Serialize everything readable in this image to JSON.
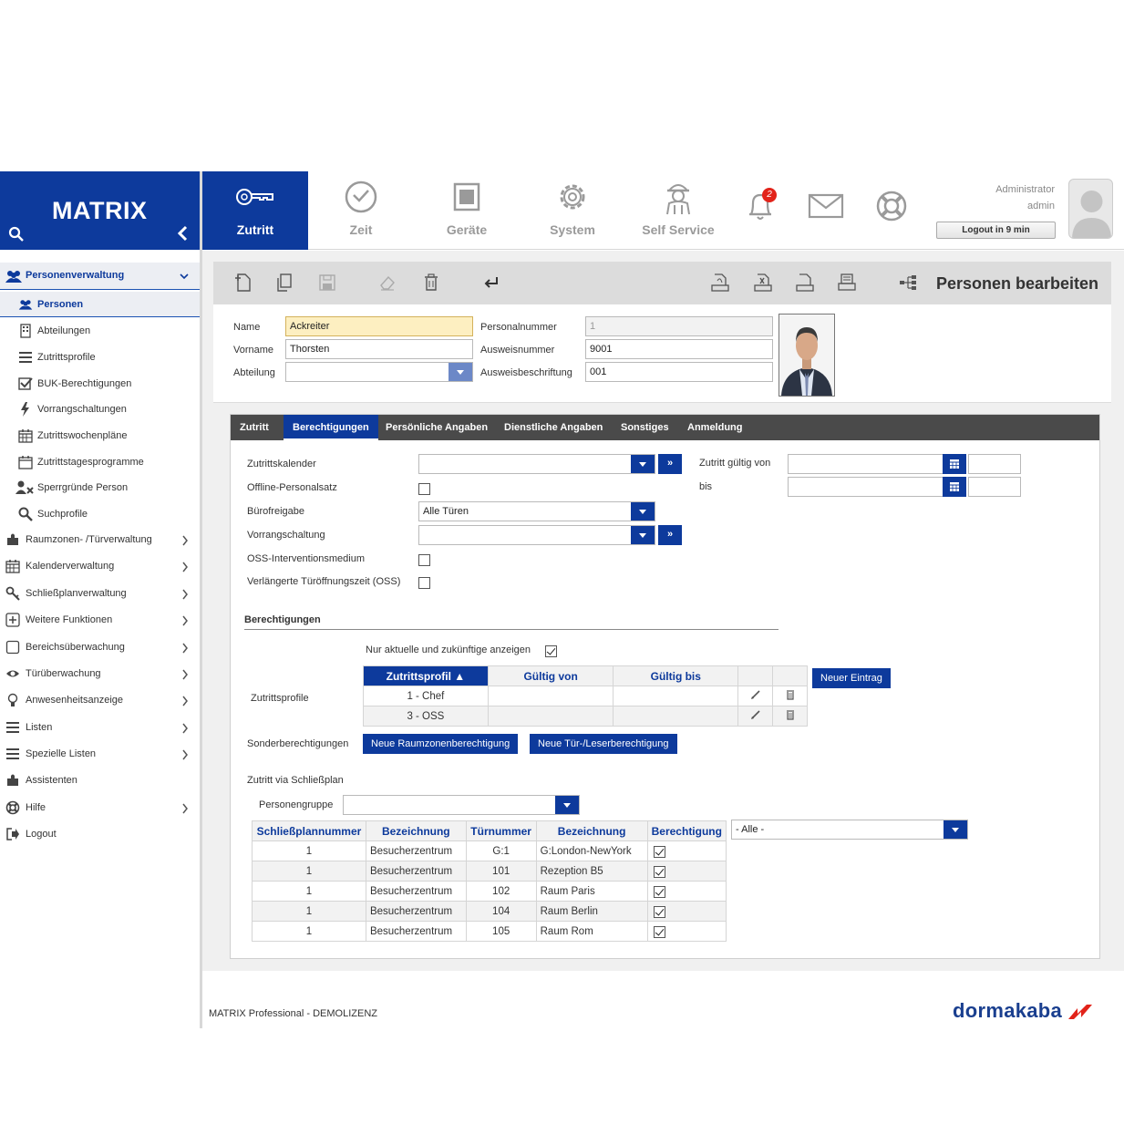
{
  "app": {
    "title": "MATRIX",
    "page_title": "Personen bearbeiten",
    "brand_color": "#0d3a9c"
  },
  "nav": {
    "tabs": [
      {
        "label": "Zutritt",
        "icon": "key-icon",
        "active": true
      },
      {
        "label": "Zeit",
        "icon": "clock-icon"
      },
      {
        "label": "Geräte",
        "icon": "device-icon"
      },
      {
        "label": "System",
        "icon": "gear-icon"
      },
      {
        "label": "Self Service",
        "icon": "worker-icon"
      }
    ],
    "notifications_count": "2",
    "user_role": "Administrator",
    "user_name": "admin",
    "logout_label": "Logout in 9 min"
  },
  "sidebar": {
    "group_label": "Personenverwaltung",
    "subitems": [
      {
        "label": "Personen",
        "icon": "people-icon"
      },
      {
        "label": "Abteilungen",
        "icon": "building-icon"
      },
      {
        "label": "Zutrittsprofile",
        "icon": "list-icon"
      },
      {
        "label": "BUK-Berechtigungen",
        "icon": "checkbox-icon"
      },
      {
        "label": "Vorrangschaltungen",
        "icon": "lightning-icon"
      },
      {
        "label": "Zutrittswochenpläne",
        "icon": "calendar-icon"
      },
      {
        "label": "Zutrittstagesprogramme",
        "icon": "calendar-day-icon"
      },
      {
        "label": "Sperrgründe Person",
        "icon": "person-block-icon"
      },
      {
        "label": "Suchprofile",
        "icon": "search-icon"
      }
    ],
    "items": [
      {
        "label": "Raumzonen- /Türverwaltung",
        "icon": "puzzle-icon"
      },
      {
        "label": "Kalenderverwaltung",
        "icon": "calendar-icon"
      },
      {
        "label": "Schließplanverwaltung",
        "icon": "keys-icon"
      },
      {
        "label": "Weitere Funktionen",
        "icon": "plus-box-icon"
      },
      {
        "label": "Bereichsüberwachung",
        "icon": "square-icon"
      },
      {
        "label": "Türüberwachung",
        "icon": "eye-icon"
      },
      {
        "label": "Anwesenheitsanzeige",
        "icon": "bulb-icon"
      },
      {
        "label": "Listen",
        "icon": "list-icon"
      },
      {
        "label": "Spezielle Listen",
        "icon": "list-icon"
      },
      {
        "label": "Assistenten",
        "icon": "puzzle-icon"
      },
      {
        "label": "Hilfe",
        "icon": "lifebuoy-icon"
      },
      {
        "label": "Logout",
        "icon": "logout-icon"
      }
    ]
  },
  "person": {
    "name_label": "Name",
    "name_value": "Ackreiter",
    "vorname_label": "Vorname",
    "vorname_value": "Thorsten",
    "abteilung_label": "Abteilung",
    "abteilung_value": "",
    "personalnummer_label": "Personalnummer",
    "personalnummer_value": "1",
    "ausweisnummer_label": "Ausweisnummer",
    "ausweisnummer_value": "9001",
    "ausweisbeschriftung_label": "Ausweisbeschriftung",
    "ausweisbeschriftung_value": "001"
  },
  "tabs": [
    "Zutritt",
    "Berechtigungen",
    "Persönliche Angaben",
    "Dienstliche Angaben",
    "Sonstiges",
    "Anmeldung"
  ],
  "form": {
    "zutrittskalender_label": "Zutrittskalender",
    "offline_label": "Offline-Personalsatz",
    "buerofreigabe_label": "Bürofreigabe",
    "buerofreigabe_value": "Alle Türen",
    "vorrangschaltung_label": "Vorrangschaltung",
    "oss_label": "OSS-Interventionsmedium",
    "verlaengert_label": "Verlängerte Türöffnungszeit (OSS)",
    "gueltig_von_label": "Zutritt gültig von",
    "bis_label": "bis"
  },
  "berechtigungen": {
    "heading": "Berechtigungen",
    "only_current_label": "Nur aktuelle und zukünftige anzeigen",
    "profiles_label": "Zutrittsprofile",
    "columns": [
      "Zutrittsprofil",
      "Gültig von",
      "Gültig bis"
    ],
    "rows": [
      {
        "profil": "1 - Chef",
        "von": "",
        "bis": ""
      },
      {
        "profil": "3 - OSS",
        "von": "",
        "bis": ""
      }
    ],
    "new_entry_label": "Neuer Eintrag",
    "sonder_label": "Sonderberechtigungen",
    "btn_raumzone": "Neue Raumzonenberechtigung",
    "btn_tuer": "Neue Tür-/Leserberechtigung"
  },
  "schliessplan": {
    "heading": "Zutritt via Schließplan",
    "personengruppe_label": "Personengruppe",
    "personengruppe_value": "",
    "filter_value": "- Alle -",
    "columns": [
      "Schließplannummer",
      "Bezeichnung",
      "Türnummer",
      "Bezeichnung",
      "Berechtigung"
    ],
    "rows": [
      {
        "nr": "1",
        "bez": "Besucherzentrum",
        "tuer": "G:1",
        "tuerbez": "G:London-NewYork"
      },
      {
        "nr": "1",
        "bez": "Besucherzentrum",
        "tuer": "101",
        "tuerbez": "Rezeption B5"
      },
      {
        "nr": "1",
        "bez": "Besucherzentrum",
        "tuer": "102",
        "tuerbez": "Raum Paris"
      },
      {
        "nr": "1",
        "bez": "Besucherzentrum",
        "tuer": "104",
        "tuerbez": "Raum Berlin"
      },
      {
        "nr": "1",
        "bez": "Besucherzentrum",
        "tuer": "105",
        "tuerbez": "Raum Rom"
      }
    ]
  },
  "footer": {
    "license": "MATRIX Professional - DEMOLIZENZ",
    "logo": "dormakaba"
  }
}
